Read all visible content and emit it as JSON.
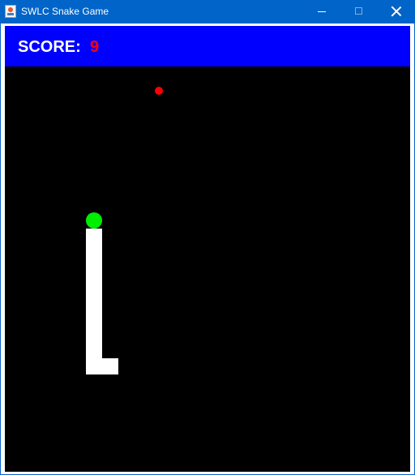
{
  "window": {
    "title": "SWLC Snake Game",
    "icon": "java-cup-icon",
    "controls": [
      "minimize-icon",
      "maximize-icon",
      "close-icon"
    ]
  },
  "scorebar": {
    "label": "SCORE:",
    "value": "9",
    "background_color": "#0000ff",
    "label_color": "#ffffff",
    "value_color": "#ff0000"
  },
  "board": {
    "background_color": "#000000",
    "snake_head_color": "#00ee00",
    "snake_body_color": "#ffffff",
    "food_color": "#ff0000"
  }
}
